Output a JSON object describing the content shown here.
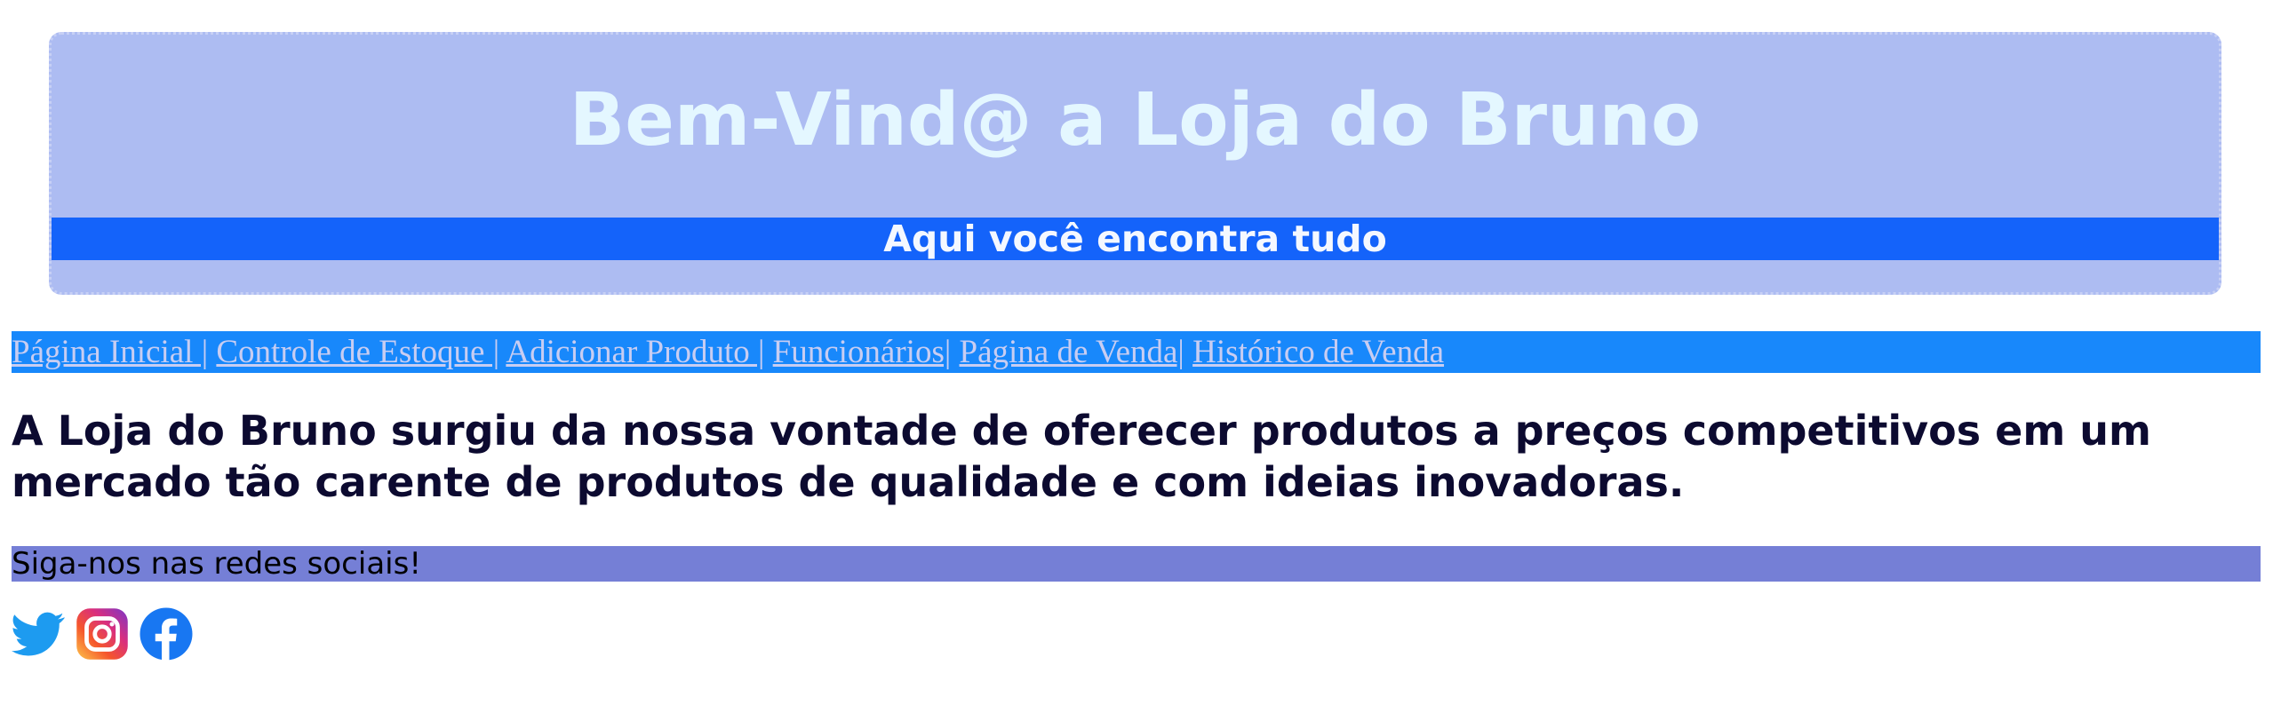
{
  "header": {
    "title": "Bem-Vind@ a Loja do Bruno",
    "tagline": "Aqui você encontra tudo"
  },
  "nav": {
    "items": [
      {
        "label": "Página Inicial |"
      },
      {
        "label": "Controle de Estoque |"
      },
      {
        "label": "Adicionar Produto |"
      },
      {
        "label": "Funcionários|"
      },
      {
        "label": "Página de Venda|"
      },
      {
        "label": "Histórico de Venda"
      }
    ]
  },
  "main": {
    "intro": "A Loja do Bruno surgiu da nossa vontade de oferecer produtos a preços competitivos em um mercado tão carente de produtos de qualidade e com ideias inovadoras."
  },
  "social": {
    "heading": "Siga-nos nas redes sociais!",
    "icons": [
      "twitter-icon",
      "instagram-icon",
      "facebook-icon"
    ]
  },
  "colors": {
    "header_bg": "#adbcf2",
    "tagline_bg": "#1463fa",
    "nav_bg": "#1888fb",
    "social_bar_bg": "#757fd6",
    "intro_text": "#0c0a30"
  }
}
